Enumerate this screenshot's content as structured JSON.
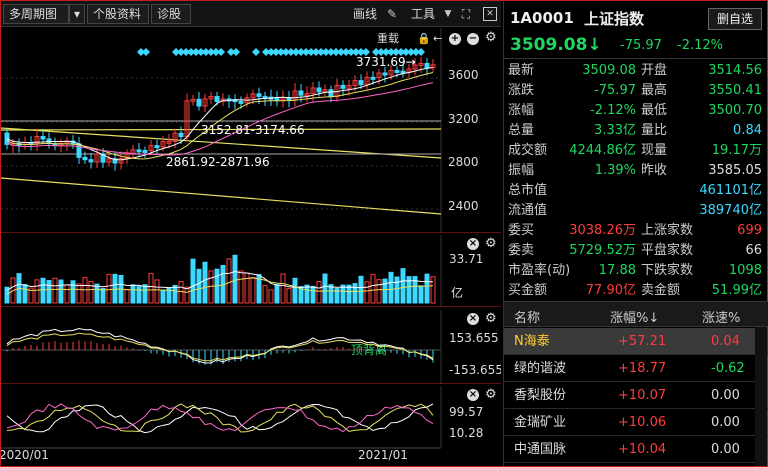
{
  "toolbar": {
    "period_label": "多周期图",
    "dropdown_icon": "caret-down-icon",
    "stock_info_label": "个股资料",
    "diagnose_label": "诊股",
    "draw_label": "画线",
    "tools_label": "工具"
  },
  "kchart": {
    "overlay_label": "重载",
    "price_labels": [
      "3600",
      "3200",
      "2800",
      "2400"
    ],
    "annotation_high": "3731.69→",
    "annotation_mid": "3152.81-3174.66",
    "annotation_low": "2861.92-2871.96",
    "date_labels": [
      "2020/01",
      "2021/01"
    ]
  },
  "volume": {
    "top_label": "33.71",
    "unit_label": "亿"
  },
  "macd": {
    "top_label": "153.655",
    "bottom_label": "-153.655",
    "signal_label": "顶背离"
  },
  "kdj": {
    "top_label": "99.57",
    "bottom_label": "10.28"
  },
  "quote": {
    "code": "1A0001",
    "name": "上证指数",
    "watch_label": "删自选",
    "price": "3509.08",
    "change": "-75.97",
    "change_pct": "-2.12%",
    "rows": [
      {
        "l1": "最新",
        "v1": "3509.08",
        "c1": "green",
        "l2": "开盘",
        "v2": "3514.56",
        "c2": "green"
      },
      {
        "l1": "涨跌",
        "v1": "-75.97",
        "c1": "green",
        "l2": "最高",
        "v2": "3550.41",
        "c2": "green"
      },
      {
        "l1": "涨幅",
        "v1": "-2.12%",
        "c1": "green",
        "l2": "最低",
        "v2": "3500.70",
        "c2": "green"
      },
      {
        "l1": "总量",
        "v1": "3.33亿",
        "c1": "green",
        "l2": "量比",
        "v2": "0.84",
        "c2": "cyan"
      },
      {
        "l1": "成交额",
        "v1": "4244.86亿",
        "c1": "green",
        "l2": "现量",
        "v2": "19.17万",
        "c2": "green"
      },
      {
        "l1": "振幅",
        "v1": "1.39%",
        "c1": "green",
        "l2": "昨收",
        "v2": "3585.05",
        "c2": "white"
      },
      {
        "l1": "总市值",
        "v1": "",
        "c1": "white",
        "l2": "",
        "v2": "461101亿",
        "c2": "cyan"
      },
      {
        "l1": "流通值",
        "v1": "",
        "c1": "white",
        "l2": "",
        "v2": "389740亿",
        "c2": "cyan"
      },
      {
        "l1": "委买",
        "v1": "3038.26万",
        "c1": "red",
        "l2": "上涨家数",
        "v2": "699",
        "c2": "red"
      },
      {
        "l1": "委卖",
        "v1": "5729.52万",
        "c1": "green",
        "l2": "平盘家数",
        "v2": "66",
        "c2": "white"
      },
      {
        "l1": "市盈率(动)",
        "v1": "17.88",
        "c1": "green",
        "l2": "下跌家数",
        "v2": "1098",
        "c2": "green"
      },
      {
        "l1": "买金额",
        "v1": "77.90亿",
        "c1": "red",
        "l2": "卖金额",
        "v2": "51.99亿",
        "c2": "green"
      }
    ]
  },
  "table": {
    "col_name": "名称",
    "col_pct": "涨幅%↓",
    "col_speed": "涨速%",
    "rows": [
      {
        "name": "N海泰",
        "pct": "+57.21",
        "speed": "0.04",
        "name_color": "#ffcc33",
        "speed_color": "#ff3b3b"
      },
      {
        "name": "绿的谐波",
        "pct": "+18.77",
        "speed": "-0.62",
        "name_color": "#ddd",
        "speed_color": "#1ed760"
      },
      {
        "name": "香梨股份",
        "pct": "+10.07",
        "speed": "0.00",
        "name_color": "#ddd",
        "speed_color": "#ddd"
      },
      {
        "name": "金瑞矿业",
        "pct": "+10.06",
        "speed": "0.00",
        "name_color": "#ddd",
        "speed_color": "#ddd"
      },
      {
        "name": "中通国脉",
        "pct": "+10.04",
        "speed": "0.00",
        "name_color": "#ddd",
        "speed_color": "#ddd"
      }
    ]
  }
}
